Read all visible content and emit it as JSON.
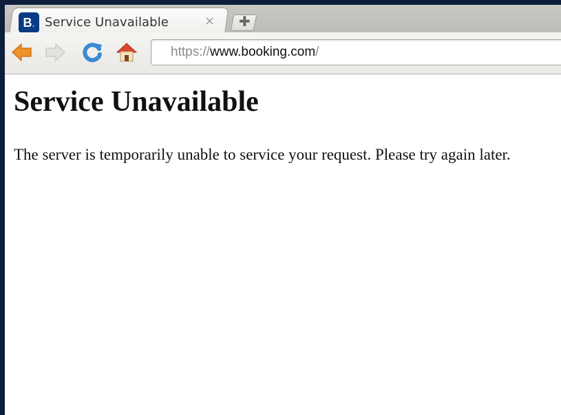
{
  "browser": {
    "tab": {
      "favicon_letter": "B",
      "favicon_dot": ".",
      "title": "Service Unavailable",
      "close_glyph": "×"
    },
    "new_tab_glyph": "✚",
    "toolbar": {
      "back_icon": "back-arrow-icon",
      "forward_icon": "forward-arrow-icon",
      "reload_icon": "reload-icon",
      "home_icon": "home-icon"
    },
    "url": {
      "scheme": "https://",
      "host": "www.booking.com",
      "path": "/"
    }
  },
  "page": {
    "heading": "Service Unavailable",
    "message": "The server is temporarily unable to service your request. Please try again later."
  },
  "colors": {
    "frame_background": "#0f1e3d",
    "back_arrow": "#f0922a",
    "reload": "#3a8ad4",
    "home_roof": "#d9482b",
    "favicon_bg": "#0b3a84"
  }
}
